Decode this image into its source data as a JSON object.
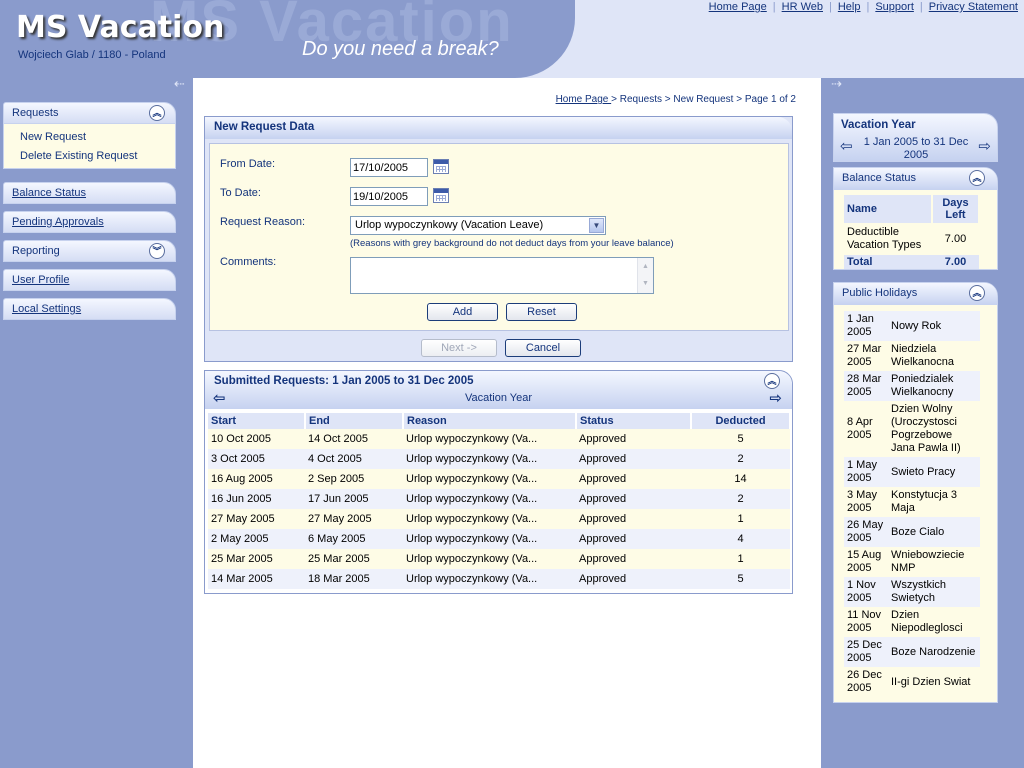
{
  "header": {
    "app_title": "MS Vacation",
    "watermark": "MS Vacation",
    "user_info": "Wojciech Glab / 1180 - Poland",
    "tagline": "Do you need a break?",
    "links": [
      "Home Page",
      "HR Web",
      "Help",
      "Support",
      "Privacy Statement"
    ],
    "separator": "|"
  },
  "arrows": {
    "left": "⇠",
    "right": "⇢"
  },
  "sidebar": {
    "requests": {
      "label": "Requests",
      "toggle": "︽",
      "items": [
        "New Request",
        "Delete Existing Request"
      ]
    },
    "balance_status": "Balance Status",
    "pending_approvals": "Pending Approvals",
    "reporting": {
      "label": "Reporting",
      "toggle": "︾"
    },
    "user_profile": "User Profile",
    "local_settings": "Local Settings"
  },
  "breadcrumb": {
    "home": "Home Page ",
    "rest": "> Requests > New Request > Page 1 of 2"
  },
  "new_request": {
    "title": "New Request Data",
    "from_label": "From Date:",
    "from_value": "17/10/2005",
    "to_label": "To Date:",
    "to_value": "19/10/2005",
    "reason_label": "Request Reason:",
    "reason_value": "Urlop wypoczynkowy (Vacation Leave)",
    "reason_dropdown": "▼",
    "reason_note": "(Reasons with grey background do not deduct days from your leave balance)",
    "comments_label": "Comments:",
    "comments_value": "",
    "scroll_up": "▲",
    "scroll_down": "▼",
    "add_button": "Add",
    "reset_button": "Reset",
    "next_button": "Next ->",
    "cancel_button": "Cancel"
  },
  "submitted": {
    "title": "Submitted Requests: 1 Jan 2005 to 31 Dec 2005",
    "toggle": "︽",
    "period_label": "Vacation Year",
    "prev": "⇦",
    "next": "⇨",
    "columns": [
      "Start",
      "End",
      "Reason",
      "Status",
      "Deducted"
    ],
    "rows": [
      {
        "start": "10 Oct 2005",
        "end": "14 Oct 2005",
        "reason": "Urlop wypoczynkowy (Va...",
        "status": "Approved",
        "deducted": "5"
      },
      {
        "start": "3 Oct 2005",
        "end": "4 Oct 2005",
        "reason": "Urlop wypoczynkowy (Va...",
        "status": "Approved",
        "deducted": "2"
      },
      {
        "start": "16 Aug 2005",
        "end": "2 Sep 2005",
        "reason": "Urlop wypoczynkowy (Va...",
        "status": "Approved",
        "deducted": "14"
      },
      {
        "start": "16 Jun 2005",
        "end": "17 Jun 2005",
        "reason": "Urlop wypoczynkowy (Va...",
        "status": "Approved",
        "deducted": "2"
      },
      {
        "start": "27 May 2005",
        "end": "27 May 2005",
        "reason": "Urlop wypoczynkowy (Va...",
        "status": "Approved",
        "deducted": "1"
      },
      {
        "start": "2 May 2005",
        "end": "6 May 2005",
        "reason": "Urlop wypoczynkowy (Va...",
        "status": "Approved",
        "deducted": "4"
      },
      {
        "start": "25 Mar 2005",
        "end": "25 Mar 2005",
        "reason": "Urlop wypoczynkowy (Va...",
        "status": "Approved",
        "deducted": "1"
      },
      {
        "start": "14 Mar 2005",
        "end": "18 Mar 2005",
        "reason": "Urlop wypoczynkowy (Va...",
        "status": "Approved",
        "deducted": "5"
      }
    ]
  },
  "vacation_year": {
    "title": "Vacation Year",
    "range": "1 Jan 2005 to 31 Dec 2005",
    "prev": "⇦",
    "next": "⇨"
  },
  "balance": {
    "title": "Balance Status",
    "toggle": "︽",
    "col_name": "Name",
    "col_days": "Days Left",
    "rows": [
      {
        "name": "Deductible Vacation Types",
        "days": "7.00"
      }
    ],
    "total_label": "Total",
    "total_value": "7.00"
  },
  "holidays": {
    "title": "Public Holidays",
    "toggle": "︽",
    "rows": [
      {
        "date": "1 Jan 2005",
        "name": "Nowy Rok"
      },
      {
        "date": "27 Mar 2005",
        "name": "Niedziela Wielkanocna"
      },
      {
        "date": "28 Mar 2005",
        "name": "Poniedzialek Wielkanocny"
      },
      {
        "date": "8 Apr 2005",
        "name": "Dzien Wolny (Uroczystosci Pogrzebowe Jana Pawla II)"
      },
      {
        "date": "1 May 2005",
        "name": "Swieto Pracy"
      },
      {
        "date": "3 May 2005",
        "name": "Konstytucja 3 Maja"
      },
      {
        "date": "26 May 2005",
        "name": "Boze Cialo"
      },
      {
        "date": "15 Aug 2005",
        "name": "Wniebowziecie NMP"
      },
      {
        "date": "1 Nov 2005",
        "name": "Wszystkich Swietych"
      },
      {
        "date": "11 Nov 2005",
        "name": "Dzien Niepodleglosci"
      },
      {
        "date": "25 Dec 2005",
        "name": "Boze Narodzenie"
      },
      {
        "date": "26 Dec 2005",
        "name": "II-gi Dzien Swiat"
      }
    ]
  },
  "colors": {
    "background": "#8a9bcc",
    "header_light": "#dfe5f7",
    "link": "#14347c",
    "panel_cream": "#fefce6"
  }
}
